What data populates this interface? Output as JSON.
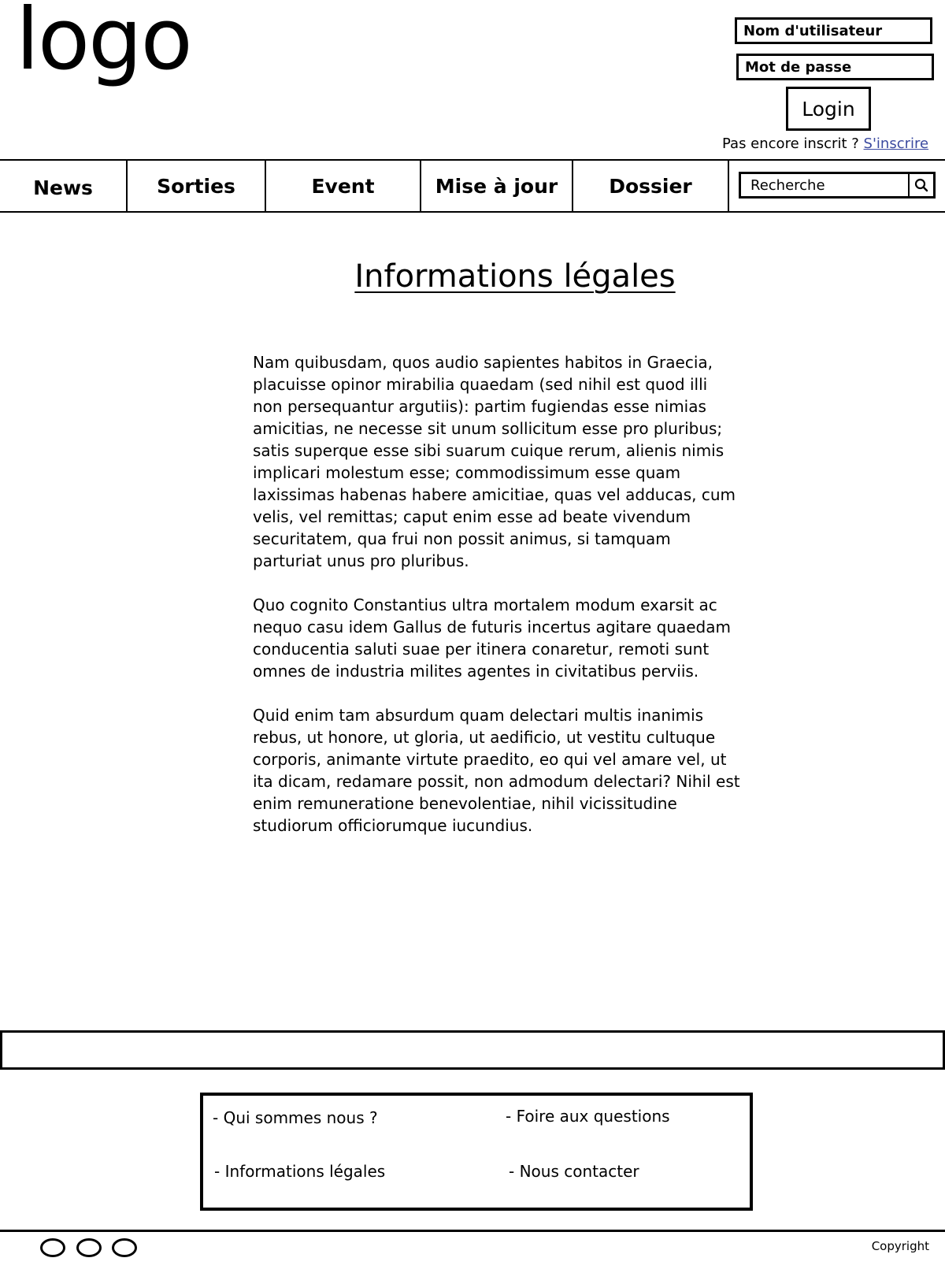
{
  "header": {
    "logo_text": "logo",
    "login": {
      "username_placeholder": "Nom d'utilisateur",
      "password_placeholder": "Mot de passe",
      "button_label": "Login",
      "signup_prompt": "Pas encore inscrit ?",
      "signup_link": "S'inscrire"
    }
  },
  "nav": {
    "tabs": [
      {
        "label": "News"
      },
      {
        "label": "Sorties"
      },
      {
        "label": "Event"
      },
      {
        "label": "Mise à jour"
      },
      {
        "label": "Dossier"
      }
    ],
    "search": {
      "placeholder": "Recherche",
      "icon": "search-icon"
    }
  },
  "main": {
    "title": "Informations légales",
    "paragraphs": [
      "Nam quibusdam, quos audio sapientes habitos in Graecia, placuisse opinor mirabilia quaedam (sed nihil est quod illi non persequantur argutiis): partim fugiendas esse nimias amicitias, ne necesse sit unum sollicitum esse pro pluribus; satis superque esse sibi suarum cuique rerum, alienis nimis implicari molestum esse; commodissimum esse quam laxissimas habenas habere amicitiae, quas vel adducas, cum velis, vel remittas; caput enim esse ad beate vivendum securitatem, qua frui non possit animus, si tamquam parturiat unus pro pluribus.",
      "Quo cognito Constantius ultra mortalem modum exarsit ac nequo casu idem Gallus de futuris incertus agitare quaedam conducentia saluti suae per itinera conaretur, remoti sunt omnes de industria milites agentes in civitatibus perviis.",
      "Quid enim tam absurdum quam delectari multis inanimis rebus, ut honore, ut gloria, ut aedificio, ut vestitu cultuque corporis, animante virtute praedito, eo qui vel amare vel, ut ita dicam, redamare possit, non admodum delectari? Nihil est enim remuneratione benevolentiae, nihil vicissitudine studiorum officiorumque iucundius."
    ]
  },
  "footer": {
    "links": [
      {
        "label": "- Qui sommes nous ?"
      },
      {
        "label": "- Foire aux questions"
      },
      {
        "label": "- Informations légales"
      },
      {
        "label": "- Nous contacter"
      }
    ],
    "copyright": "Copyright"
  }
}
